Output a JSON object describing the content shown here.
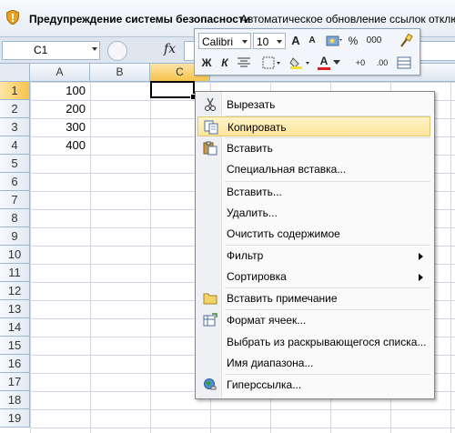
{
  "security_bar": {
    "title": "Предупреждение системы безопасности",
    "message": "Автоматическое обновление ссылок отключе"
  },
  "formula_bar": {
    "name_box": "C1",
    "fx_label": "fx",
    "formula": ""
  },
  "grid": {
    "columns": [
      "A",
      "B",
      "C"
    ],
    "rows": [
      "1",
      "2",
      "3",
      "4",
      "5",
      "6",
      "7",
      "8",
      "9",
      "10",
      "11",
      "12",
      "13",
      "14",
      "15",
      "16",
      "17",
      "18",
      "19"
    ],
    "cells": [
      {
        "ref": "A1",
        "value": "100"
      },
      {
        "ref": "A2",
        "value": "200"
      },
      {
        "ref": "A3",
        "value": "300"
      },
      {
        "ref": "A4",
        "value": "400"
      }
    ]
  },
  "mini_toolbar": {
    "font_name": "Calibri",
    "font_size": "10",
    "grow_font": "A",
    "shrink_font": "A",
    "currency": "%",
    "thousands": "000",
    "bold": "Ж",
    "italic": "К",
    "font_color_letter": "A",
    "increase_decimal": "+0",
    "decrease_decimal": ".00"
  },
  "context_menu": {
    "items": [
      {
        "label": "Вырезать",
        "icon": "scissors-icon"
      },
      {
        "label": "Копировать",
        "icon": "copy-icon",
        "highlighted": true
      },
      {
        "label": "Вставить",
        "icon": "paste-icon"
      },
      {
        "label": "Специальная вставка...",
        "icon": ""
      },
      {
        "label": "Вставить...",
        "icon": ""
      },
      {
        "label": "Удалить...",
        "icon": ""
      },
      {
        "label": "Очистить содержимое",
        "icon": ""
      },
      {
        "label": "Фильтр",
        "icon": "",
        "submenu": true
      },
      {
        "label": "Сортировка",
        "icon": "",
        "submenu": true
      },
      {
        "label": "Вставить примечание",
        "icon": "comment-icon"
      },
      {
        "label": "Формат ячеек...",
        "icon": "format-cells-icon"
      },
      {
        "label": "Выбрать из раскрывающегося списка...",
        "icon": ""
      },
      {
        "label": "Имя диапазона...",
        "icon": ""
      },
      {
        "label": "Гиперссылка...",
        "icon": "hyperlink-icon"
      }
    ]
  }
}
